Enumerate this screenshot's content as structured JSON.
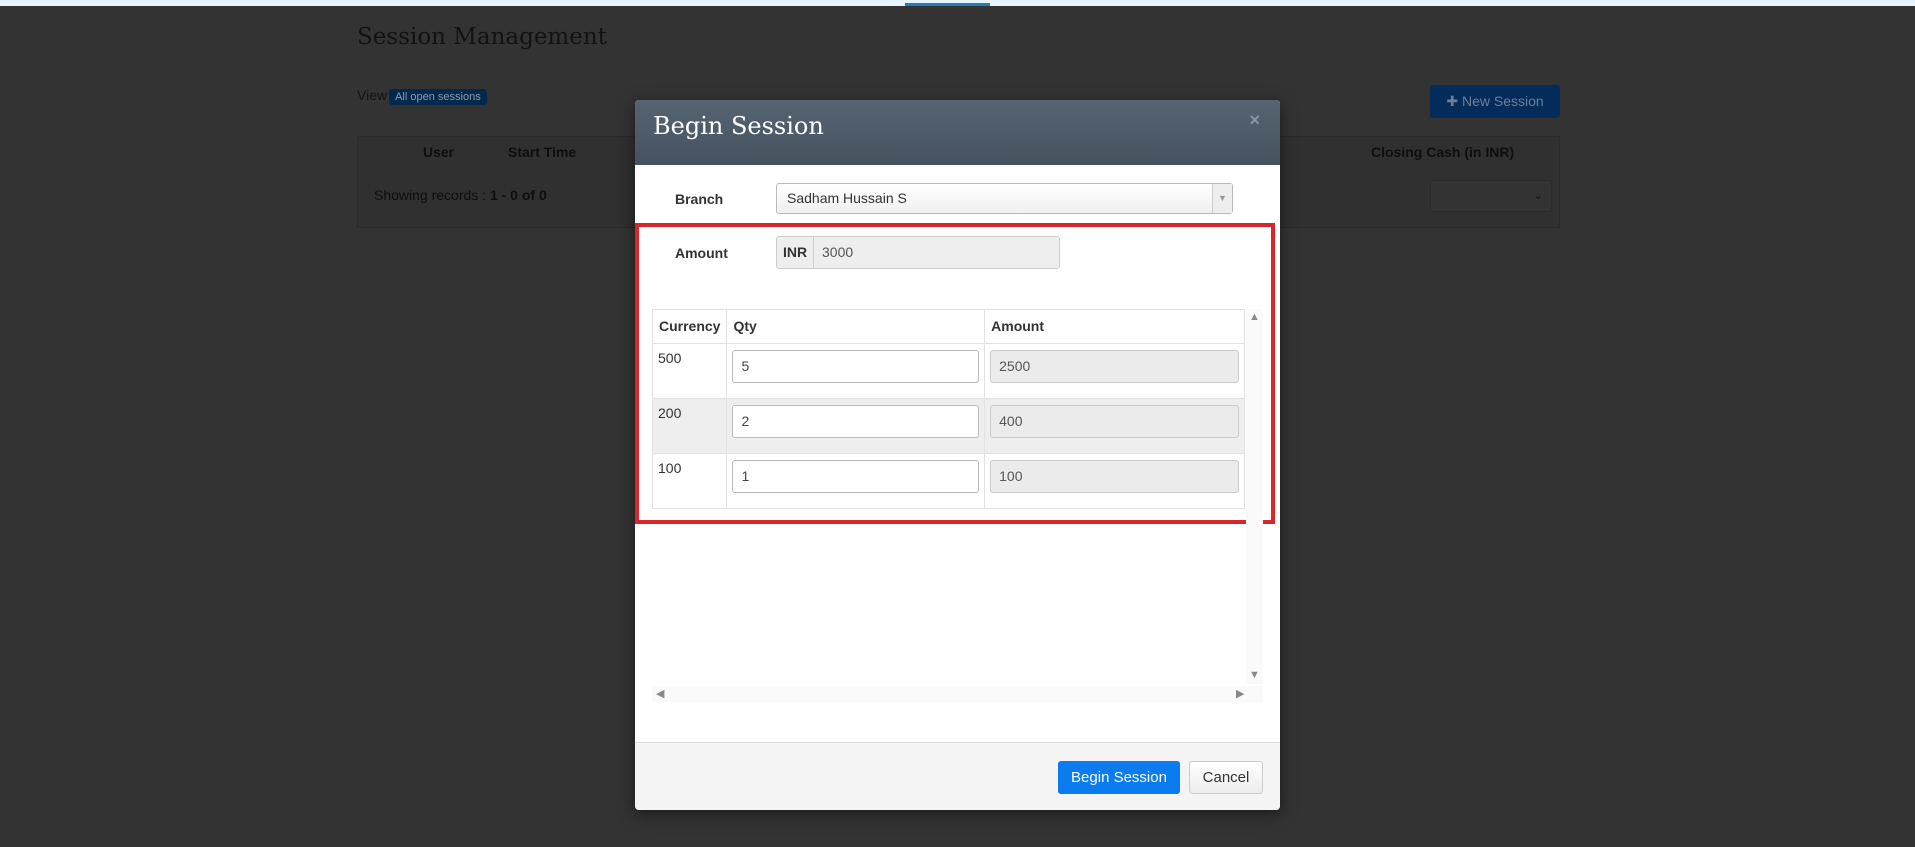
{
  "page": {
    "title": "Session Management",
    "view_label": "View",
    "view_filter": "All open sessions",
    "new_session": "New Session",
    "columns": [
      "User",
      "Start Time",
      "Closing Cash (in INR)"
    ],
    "showing_label": "Showing records : ",
    "showing_value": "1 - 0 of 0"
  },
  "modal": {
    "title": "Begin Session",
    "close": "×",
    "branch_label": "Branch",
    "branch_value": "Sadham Hussain S",
    "amount_label": "Amount",
    "amount_currency": "INR",
    "amount_value": "3000",
    "grid": {
      "headers": [
        "Currency",
        "Qty",
        "Amount"
      ],
      "rows": [
        {
          "currency": "500",
          "qty": "5",
          "amount": "2500"
        },
        {
          "currency": "200",
          "qty": "2",
          "amount": "400"
        },
        {
          "currency": "100",
          "qty": "1",
          "amount": "100"
        }
      ]
    },
    "begin_button": "Begin Session",
    "cancel_button": "Cancel"
  },
  "colors": {
    "primary": "#0a7cf0",
    "highlight": "#d9262c",
    "header": "#4e5b68"
  }
}
